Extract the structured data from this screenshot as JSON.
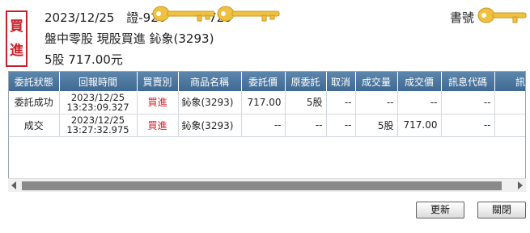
{
  "order": {
    "side_char1": "買",
    "side_char2": "進",
    "date": "2023/12/25",
    "cert_label": "證-920",
    "cert_suffix": "729",
    "account_label": "書號",
    "description": "盤中零股 現股買進 鈊象(3293)",
    "summary": "5股 717.00元"
  },
  "colors": {
    "header_bg": "#4a76a0",
    "buy_red": "#d41f2a",
    "key_gold": "#f0c040"
  },
  "table": {
    "headers": [
      "委託狀態",
      "回報時間",
      "買賣別",
      "商品名稱",
      "委託價",
      "原委託",
      "取消",
      "成交量",
      "成交價",
      "訊息代碼",
      "訊息說明"
    ],
    "rows": [
      {
        "status": "委託成功",
        "date": "2023/12/25",
        "time": "13:23:09.327",
        "side": "買進",
        "product": "鈊象(3293)",
        "price": "717.00",
        "orig_qty": "5股",
        "cancel": "--",
        "fill_qty": "--",
        "fill_price": "--",
        "msg_code": "--",
        "msg_desc": "--"
      },
      {
        "status": "成交",
        "date": "2023/12/25",
        "time": "13:27:32.975",
        "side": "買進",
        "product": "鈊象(3293)",
        "price": "--",
        "orig_qty": "--",
        "cancel": "--",
        "fill_qty": "5股",
        "fill_price": "717.00",
        "msg_code": "--",
        "msg_desc": "--"
      }
    ]
  },
  "buttons": {
    "refresh": "更新",
    "close": "關閉"
  }
}
